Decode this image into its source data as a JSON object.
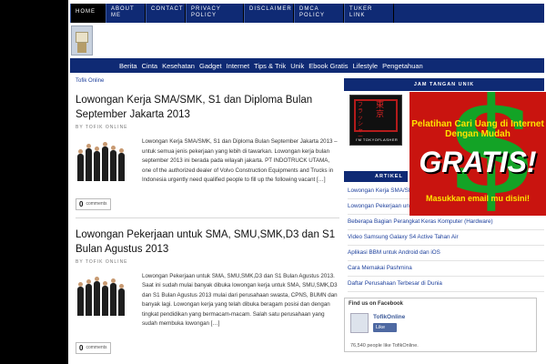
{
  "top_nav": [
    "HOME",
    "ABOUT ME",
    "CONTACT",
    "PRIVACY POLICY",
    "DISCLAIMER",
    "DMCA POLICY",
    "TUKER LINK"
  ],
  "categories": [
    "Berita",
    "Cinta",
    "Kesehatan",
    "Gadget",
    "Internet",
    "Tips & Trik",
    "Unik",
    "Ebook Gratis",
    "Lifestyle",
    "Pengetahuan"
  ],
  "breadcrumb": "Tofik Online",
  "posts": [
    {
      "title": "Lowongan Kerja SMA/SMK, S1 dan Diploma Bulan September Jakarta 2013",
      "byline": "by TOFIK ONLINE",
      "excerpt": "Lowongan Kerja SMA/SMK, S1 dan Diploma Bulan September Jakarta 2013 – untuk semua jenis pekerjaan yang lebih di tawarkan. Lowongan kerja bulan september 2013 ini berada pada wilayah jakarta. PT INDOTRUCK UTAMA, one of the authorized dealer of Volvo Construction Equipments and Trucks in Indonesia urgently need qualified people to fill up the following vacant […]",
      "comment_count": "0",
      "comment_label": "comments"
    },
    {
      "title": "Lowongan Pekerjaan untuk SMA, SMU,SMK,D3 dan S1 Bulan Agustus 2013",
      "byline": "by TOFIK ONLINE",
      "excerpt": "Lowongan Pekerjaan untuk SMA, SMU,SMK,D3 dan S1 Bulan Agustus 2013. Saat ini sudah mulai banyak dibuka lowongan kerja untuk SMA, SMU,SMK,D3 dan S1 Bulan Agustus 2013 mulai dari perusahaan swasta, CPNS, BUMN dan banyak lagi. Lowongan kerja yang telah dibuka beragam posisi dan dengan tingkat pendidikan yang bermacam-macam. Salah satu perusahaan yang sudah membuka lowongan […]",
      "comment_count": "0",
      "comment_label": "comments"
    }
  ],
  "sidebar": {
    "jam_title": "JAM TANGAN UNIK",
    "jam_kanji": "東京",
    "jam_kana": "フラッシャー",
    "jam_caption": "I'M TOKYOFLASHER",
    "articles_title": "ARTIKEL",
    "articles": [
      "Lowongan Kerja SMA/SMK, S1 dan Diploma Bulan",
      "Lowongan Pekerjaan untuk SMA, SMU,SMK,D3 dan S1 Bulan Agustus 2013",
      "Beberapa Bagian Perangkat Keras Komputer (Hardware)",
      "Video Samsung Galaxy S4 Active Tahan Air",
      "Aplikasi BBM untuk Android dan iOS",
      "Cara Memakai Pashmina",
      "Daftar Perusahaan Terbesar di Dunia"
    ],
    "fb_title": "Find us on Facebook",
    "fb_name": "TofikOnline",
    "fb_like": "Like",
    "fb_count": "76,540 people like TofikOnline."
  },
  "ad": {
    "line1": "Pelatihan Cari Uang di Internet Dengan Mudah",
    "big": "GRATIS!",
    "line3": "Masukkan email mu disini!"
  },
  "colors": {
    "nav_bg": "#0f2a74",
    "link": "#1c3f9c",
    "ad_red": "#c9140f",
    "ad_green": "#13a326",
    "ad_yellow": "#ffe400"
  }
}
